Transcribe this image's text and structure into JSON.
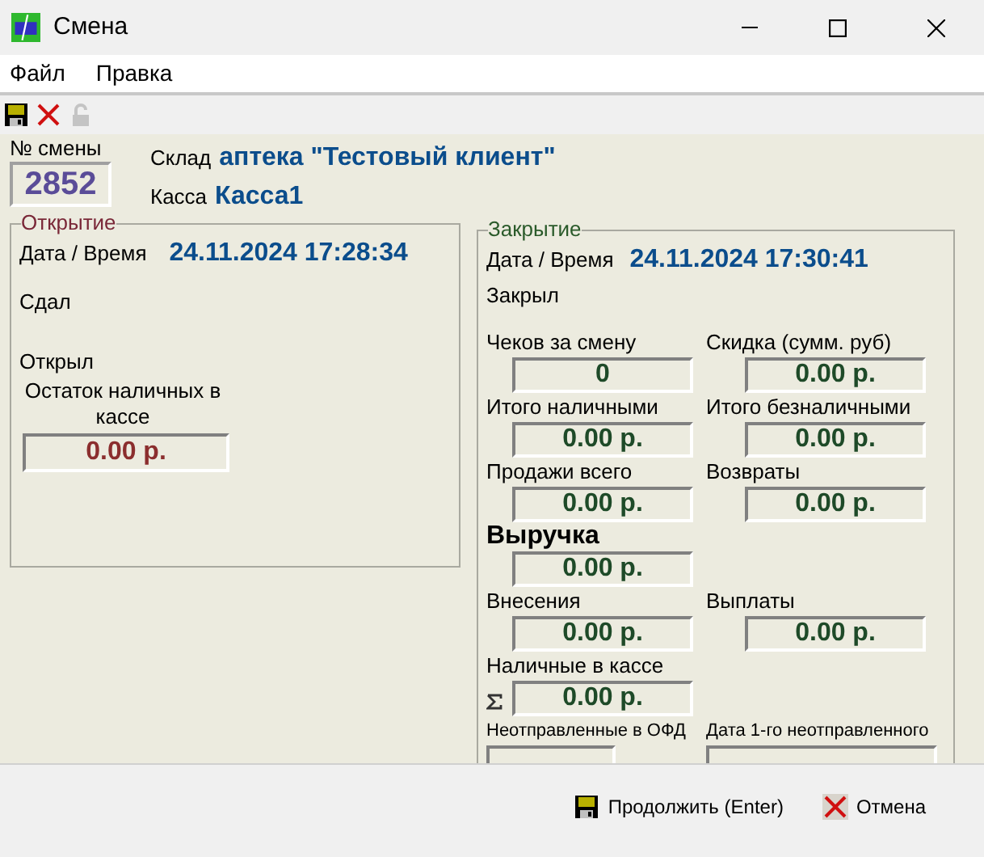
{
  "window": {
    "title": "Смена"
  },
  "menu": [
    {
      "label": "Файл"
    },
    {
      "label": "Правка"
    }
  ],
  "toolbar": [
    {
      "kind": "save",
      "disabled": false
    },
    {
      "kind": "delete",
      "disabled": false
    },
    {
      "kind": "lock",
      "disabled": true
    }
  ],
  "header": {
    "shift_label": "№ смены",
    "shift_number": "2852",
    "warehouse_label": "Склад",
    "warehouse": "аптека \"Тестовый клиент\"",
    "register_label": "Касса",
    "register": "Касса1"
  },
  "opening": {
    "legend": "Открытие",
    "datetime_label": "Дата / Время",
    "datetime": "24.11.2024 17:28:34",
    "handed_label": "Сдал",
    "opened_label": "Открыл",
    "cash_label": "Остаток наличных в кассе",
    "cash_value": "0.00 р."
  },
  "closing": {
    "legend": "Закрытие",
    "datetime_label": "Дата / Время",
    "datetime": "24.11.2024 17:30:41",
    "closed_label": "Закрыл",
    "rows": [
      [
        {
          "kind": "normal",
          "label": "Чеков за смену",
          "value": "0"
        },
        {
          "kind": "normal",
          "label": "Скидка (сумм. руб)",
          "value": "0.00 р."
        }
      ],
      [
        {
          "kind": "normal",
          "label": "Итого наличными",
          "value": "0.00 р."
        },
        {
          "kind": "normal",
          "label": "Итого безналичными",
          "value": "0.00 р."
        }
      ],
      [
        {
          "kind": "normal",
          "label": "Продажи всего",
          "value": "0.00 р."
        },
        {
          "kind": "normal",
          "label": "Возвраты",
          "value": "0.00 р."
        }
      ],
      [
        {
          "kind": "heading",
          "label": "Выручка",
          "value": "0.00 р."
        }
      ],
      [
        {
          "kind": "normal",
          "label": "Внесения",
          "value": "0.00 р."
        },
        {
          "kind": "normal",
          "label": "Выплаты",
          "value": "0.00 р."
        }
      ],
      [
        {
          "kind": "sum",
          "label": "Наличные в кассе",
          "value": "0.00 р."
        }
      ],
      [
        {
          "kind": "small",
          "label": "Неотправленные в ОФД"
        },
        {
          "kind": "small_wide",
          "label": "Дата 1-го неотправленного"
        }
      ]
    ]
  },
  "buttons": [
    {
      "kind": "save",
      "label": "Продолжить (Enter)"
    },
    {
      "kind": "cancel",
      "label": "Отмена"
    }
  ]
}
